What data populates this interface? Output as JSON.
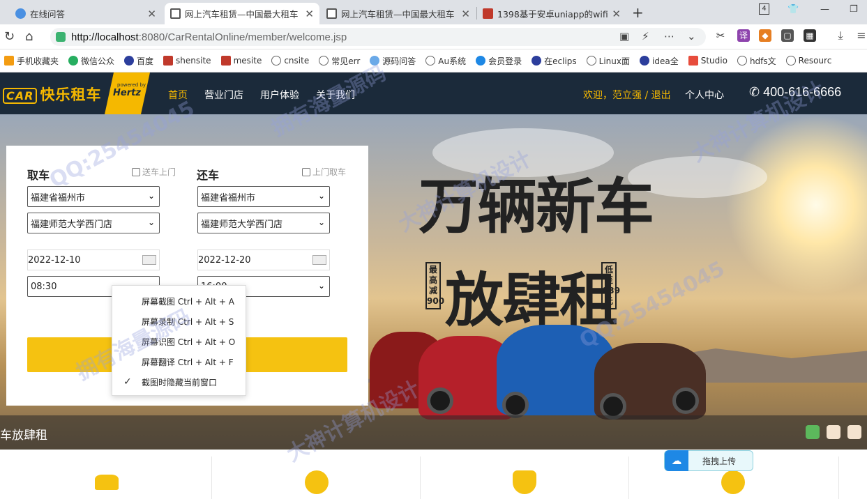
{
  "browser": {
    "tabs": [
      {
        "title": "在线问答",
        "active": false
      },
      {
        "title": "网上汽车租赁—中国最大租车",
        "active": true
      },
      {
        "title": "网上汽车租赁—中国最大租车",
        "active": false
      },
      {
        "title": "1398基于安卓uniapp的wifi和",
        "active": false
      }
    ],
    "tab_close": "✕",
    "new_tab": "+",
    "tab_count": "4",
    "url_host": "http://localhost",
    "url_rest": ":8080/CarRentalOnline/member/welcome.jsp",
    "bookmarks": [
      "手机收藏夹",
      "微信公众",
      "百度",
      "shensite",
      "mesite",
      "cnsite",
      "常见err",
      "源码问答",
      "Au系统",
      "会员登录",
      "在eclips",
      "Linux面",
      "idea全",
      "Studio",
      "hdfs文",
      "Resourc"
    ]
  },
  "site": {
    "logo_car": "CAR",
    "logo_text": "快乐租车",
    "logo_powered": "powered by",
    "logo_hertz": "Hertz",
    "nav": [
      "首页",
      "营业门店",
      "用户体验",
      "关于我们"
    ],
    "welcome": "欢迎，范立强 / 退出",
    "user_center": "个人中心",
    "phone": "400-616-6666"
  },
  "booking": {
    "pickup_title": "取车",
    "pickup_option": "送车上门",
    "return_title": "还车",
    "return_option": "上门取车",
    "pickup_city": "福建省福州市",
    "pickup_store": "福建师范大学西门店",
    "pickup_date": "2022-12-10",
    "pickup_time": "08:30",
    "return_city": "福建省福州市",
    "return_store": "福建师范大学西门店",
    "return_date": "2022-12-20",
    "return_time": "16:00"
  },
  "context_menu": {
    "items": [
      {
        "label": "屏幕截图 Ctrl + Alt + A",
        "checked": false
      },
      {
        "label": "屏幕录制 Ctrl + Alt + S",
        "checked": false
      },
      {
        "label": "屏幕识图 Ctrl + Alt + O",
        "checked": false
      },
      {
        "label": "屏幕翻译 Ctrl + Alt + F",
        "checked": false
      },
      {
        "label": "截图时隐藏当前窗口",
        "checked": true
      }
    ]
  },
  "banner": {
    "slogan_line1": "万辆新车",
    "slogan_line2": "放肆租",
    "tag_left": "最高减900",
    "tag_right": "低至139元",
    "strip_text": "车放肆租"
  },
  "upload_label": "拖拽上传",
  "watermark_qq": "QQ:25454045",
  "watermark_source": "拥有海量源码",
  "watermark_design": "大神计算机设计",
  "colors": {
    "accent": "#f5c211",
    "header": "#1b2a3a"
  }
}
